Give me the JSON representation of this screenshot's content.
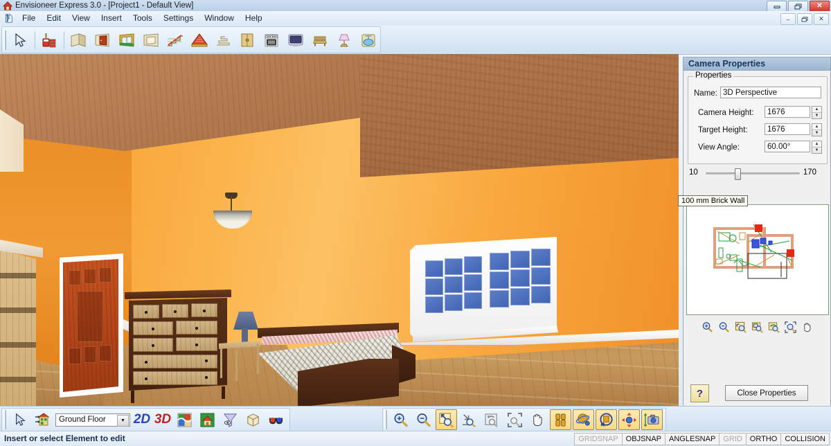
{
  "window": {
    "title": "Envisioneer Express 3.0 - [Project1 - Default View]",
    "app_icon": "house-app-icon",
    "controls": {
      "minimize": "–",
      "maximize": "❐",
      "close": "✕"
    },
    "mdi_controls": {
      "minimize": "–",
      "restore": "❐",
      "close": "✕"
    }
  },
  "menubar": {
    "icon": "document-icon",
    "items": [
      {
        "label": "File"
      },
      {
        "label": "Edit"
      },
      {
        "label": "View"
      },
      {
        "label": "Insert"
      },
      {
        "label": "Tools"
      },
      {
        "label": "Settings"
      },
      {
        "label": "Window"
      },
      {
        "label": "Help"
      }
    ]
  },
  "toolbar": {
    "buttons": [
      {
        "name": "select-arrow-tool",
        "icon": "cursor-arrow-icon"
      },
      {
        "name": "material-paint-tool",
        "icon": "paint-bucket-brick-icon"
      },
      {
        "name": "wall-tool",
        "icon": "wall-icon"
      },
      {
        "name": "door-tool",
        "icon": "door-icon"
      },
      {
        "name": "window-tool",
        "icon": "window-icon"
      },
      {
        "name": "opening-tool",
        "icon": "opening-icon"
      },
      {
        "name": "stair-tool",
        "icon": "stair-icon"
      },
      {
        "name": "roof-tool",
        "icon": "roof-icon"
      },
      {
        "name": "deck-tool",
        "icon": "deck-steps-icon"
      },
      {
        "name": "cabinet-tool",
        "icon": "cabinet-icon"
      },
      {
        "name": "appliance-tool",
        "icon": "stove-icon"
      },
      {
        "name": "electronics-tool",
        "icon": "tv-monitor-icon"
      },
      {
        "name": "furniture-tool",
        "icon": "bench-icon"
      },
      {
        "name": "lighting-tool",
        "icon": "table-lamp-icon"
      },
      {
        "name": "plumbing-tool",
        "icon": "sink-faucet-icon"
      }
    ]
  },
  "viewport": {
    "name": "3d-render-viewport",
    "scene": "bedroom-3d-perspective",
    "objects": [
      "sloped-wood-ceiling",
      "orange-walls",
      "hardwood-floor",
      "pendant-ceiling-light",
      "wooden-panel-door",
      "shelving-unit",
      "tall-dresser",
      "nightstand",
      "table-lamp",
      "double-bed",
      "double-hung-window"
    ]
  },
  "panel": {
    "title": "Camera Properties",
    "group_legend": "Properties",
    "fields": [
      {
        "label": "Name:",
        "value": "3D Perspective",
        "spinner": false
      },
      {
        "label": "Camera Height:",
        "value": "1676",
        "spinner": true
      },
      {
        "label": "Target Height:",
        "value": "1676",
        "spinner": true
      },
      {
        "label": "View Angle:",
        "value": "60.00°",
        "spinner": true
      }
    ],
    "slider": {
      "min": "10",
      "max": "170",
      "value": 31
    },
    "preview": {
      "tooltip": "100 mm Brick Wall",
      "name": "floor-plan-preview"
    },
    "preview_toolbar": [
      {
        "name": "zoom-in-button",
        "icon": "magnifier-plus-icon"
      },
      {
        "name": "zoom-out-button",
        "icon": "magnifier-minus-icon"
      },
      {
        "name": "zoom-window-button",
        "icon": "zoom-window-icon"
      },
      {
        "name": "zoom-extents-button",
        "icon": "zoom-extents-icon"
      },
      {
        "name": "zoom-previous-button",
        "icon": "zoom-previous-icon"
      },
      {
        "name": "zoom-all-button",
        "icon": "zoom-all-icon"
      },
      {
        "name": "pan-button",
        "icon": "hand-pan-icon"
      }
    ],
    "help_label": "?",
    "close_label": "Close Properties"
  },
  "bottom_toolbar_left": {
    "select_icon": "cursor-arrow-icon",
    "level_icon": "building-levels-icon",
    "floor_value": "Ground Floor",
    "dropdown_arrow": "▼",
    "label_2d": "2D",
    "label_3d": "3D",
    "buttons": [
      {
        "name": "render-view-button",
        "icon": "color-puzzle-icon"
      },
      {
        "name": "elevation-view-button",
        "icon": "house-elevation-icon"
      },
      {
        "name": "view-filter-button",
        "icon": "funnel-eye-icon"
      },
      {
        "name": "box-view-button",
        "icon": "wireframe-box-icon"
      },
      {
        "name": "stereo-view-button",
        "icon": "3d-glasses-icon"
      }
    ]
  },
  "bottom_toolbar_center": {
    "buttons": [
      {
        "name": "zoom-in-button",
        "icon": "magnifier-plus-icon",
        "active": false
      },
      {
        "name": "zoom-out-button",
        "icon": "magnifier-minus-icon",
        "active": false
      },
      {
        "name": "zoom-extents-button",
        "icon": "zoom-extents-icon",
        "active": true
      },
      {
        "name": "zoom-corner-button",
        "icon": "zoom-corner-icon",
        "active": false
      },
      {
        "name": "zoom-previous-button",
        "icon": "zoom-previous-icon",
        "active": false
      },
      {
        "name": "zoom-fit-button",
        "icon": "zoom-fit-icon",
        "active": false
      },
      {
        "name": "pan-button",
        "icon": "hand-pan-icon",
        "active": false
      },
      {
        "name": "walk-through-button",
        "icon": "walk-legs-icon",
        "active": true
      },
      {
        "name": "orbit-button",
        "icon": "orbit-sphere-icon",
        "active": true
      },
      {
        "name": "turn-view-button",
        "icon": "turn-view-icon",
        "active": true
      },
      {
        "name": "move-camera-button",
        "icon": "move-arrows-icon",
        "active": true
      },
      {
        "name": "camera-height-button",
        "icon": "camera-icon",
        "active": true
      }
    ]
  },
  "statusbar": {
    "message": "Insert or select Element to edit",
    "flags": [
      {
        "label": "GRIDSNAP",
        "enabled": false
      },
      {
        "label": "OBJSNAP",
        "enabled": true
      },
      {
        "label": "ANGLESNAP",
        "enabled": true
      },
      {
        "label": "GRID",
        "enabled": false
      },
      {
        "label": "ORTHO",
        "enabled": true
      },
      {
        "label": "COLLISION",
        "enabled": true
      }
    ]
  },
  "colors": {
    "titlebar": "#b9d0e8",
    "panel_header": "#9db7d2",
    "wall_orange": "#f9a93f",
    "ceiling_wood": "#a96f45",
    "floor_wood": "#c79a5e",
    "accent_2d": "#2b44b8",
    "accent_3d": "#c02020",
    "active_button": "#f6d98a"
  }
}
